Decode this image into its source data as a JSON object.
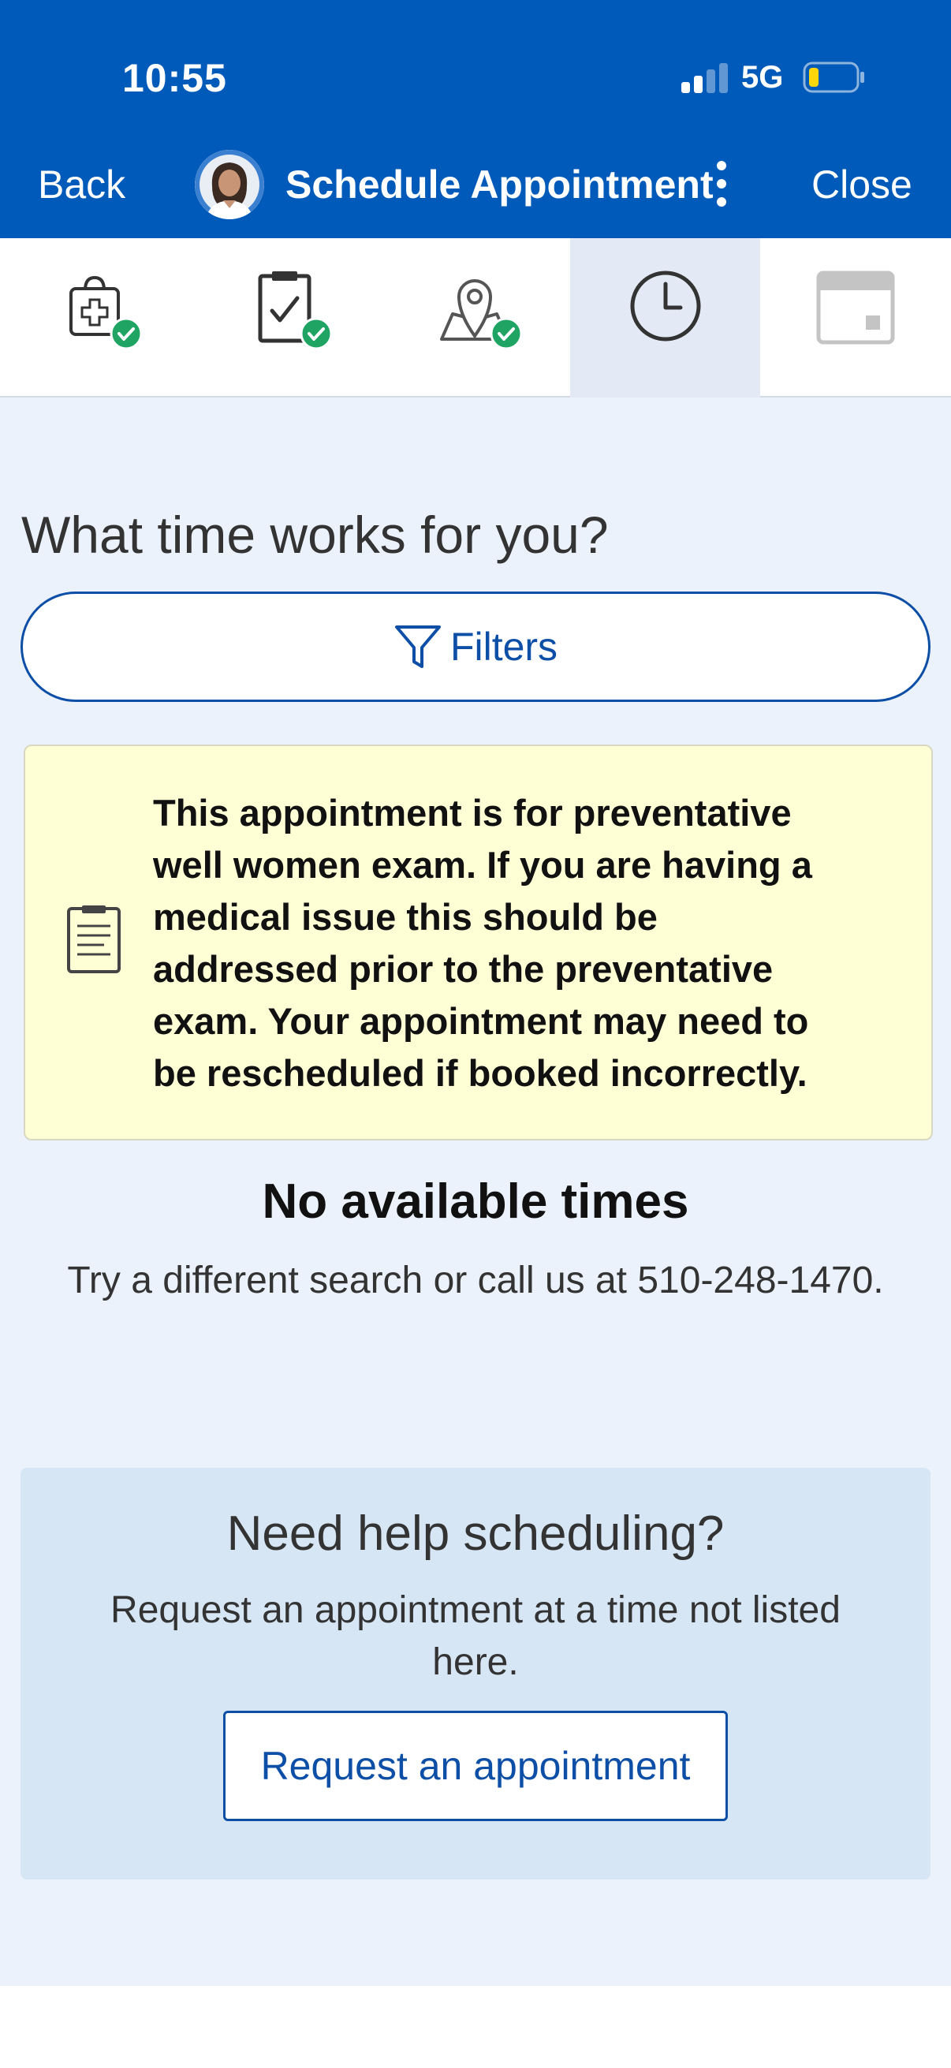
{
  "status_bar": {
    "time": "10:55",
    "network": "5G",
    "signal_bars_active": 2,
    "signal_bars_total": 4,
    "battery_level": 0.2,
    "battery_color": "#ffd60a"
  },
  "nav": {
    "back_label": "Back",
    "title": "Schedule Appointment",
    "close_label": "Close",
    "more_icon": "kebab-menu-icon"
  },
  "steps": [
    {
      "icon": "medical-bag-icon",
      "completed": true,
      "active": false
    },
    {
      "icon": "clipboard-check-icon",
      "completed": true,
      "active": false
    },
    {
      "icon": "map-pin-icon",
      "completed": true,
      "active": false
    },
    {
      "icon": "clock-icon",
      "completed": false,
      "active": true
    },
    {
      "icon": "calendar-icon",
      "completed": false,
      "active": false
    }
  ],
  "main": {
    "heading": "What time works for you?",
    "filters_label": "Filters",
    "notice_text": "This appointment is for preventative\nwell women exam.  If you are having a\nmedical issue this should be\naddressed prior to the preventative\nexam.  Your appointment may need to\nbe rescheduled if booked incorrectly.",
    "no_times_title": "No available times",
    "no_times_message": "Try a different search or call us at 510-248-1470."
  },
  "help": {
    "title": "Need help scheduling?",
    "subtitle": "Request an appointment at a time not listed here.",
    "button_label": "Request an appointment"
  },
  "colors": {
    "brand_blue": "#005ab9",
    "link_blue": "#0d4ea6",
    "success_green": "#1fa463",
    "notice_bg": "#ffffd6",
    "page_bg": "#ebf2fb",
    "help_card_bg": "#d7e6f4"
  }
}
